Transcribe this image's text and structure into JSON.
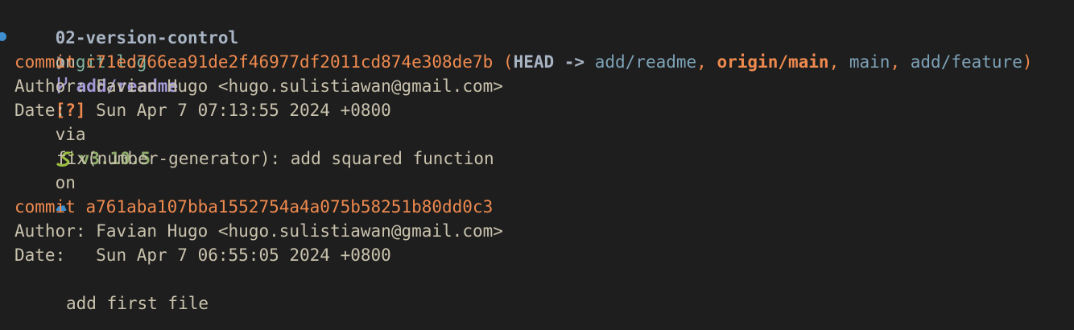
{
  "colors": {
    "background": "#1e1e1e",
    "fg": "#c9c2ad",
    "prompt_dir": "#a8b4c4",
    "branch": "#a39ad6",
    "status": "#ef8a4f",
    "python": "#8eac6a",
    "cloud": "#3e8ed0",
    "commit": "#ef8a4f",
    "ref_blue": "#7ea3b8",
    "ref_orange": "#ef8a4f",
    "git_cmd": "#7fb49e"
  },
  "prompt": {
    "dir": "02-version-control",
    "on1": "on",
    "branch_icon": "git-branch-icon",
    "branch": "add/readme",
    "status": "[?]",
    "via": "via",
    "python_icon": "snake-icon",
    "python_version": "v3.10.5",
    "on2": "on",
    "cloud_icon": "cloud-icon",
    "prompt_char": "❯",
    "command": "git log"
  },
  "commits": [
    {
      "commit_label": "commit",
      "hash": "c71ed766ea91de2f46977df2011cd874e308de7b",
      "refs": {
        "open": "(",
        "head": "HEAD ->",
        "ref1": "add/readme",
        "ref2": "origin/main",
        "ref3": "main",
        "ref4": "add/feature",
        "close": ")",
        "sep": ","
      },
      "author_label": "Author:",
      "author": "Favian Hugo <hugo.sulistiawan@gmail.com>",
      "date_label": "Date:",
      "date": "Sun Apr 7 07:13:55 2024 +0800",
      "message": "fix(number-generator): add squared function"
    },
    {
      "commit_label": "commit",
      "hash": "a761aba107bba1552754a4a075b58251b80dd0c3",
      "author_label": "Author:",
      "author": "Favian Hugo <hugo.sulistiawan@gmail.com>",
      "date_label": "Date:",
      "date": "Sun Apr 7 06:55:05 2024 +0800",
      "message": "add first file"
    }
  ]
}
